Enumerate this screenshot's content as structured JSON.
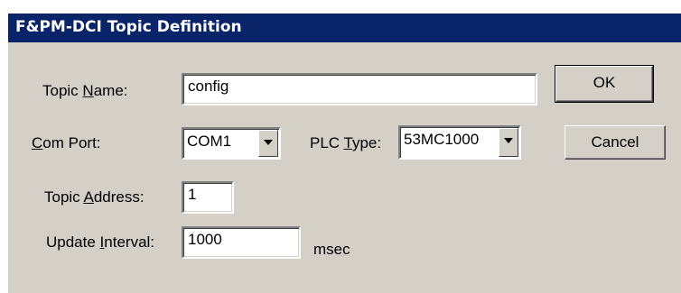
{
  "window": {
    "title": "F&PM-DCI Topic Definition"
  },
  "topic_name": {
    "label_pre": "Topic ",
    "label_accel": "N",
    "label_post": "ame:",
    "value": "config"
  },
  "com_port": {
    "label_pre": "",
    "label_accel": "C",
    "label_post": "om Port:",
    "selected": "COM1"
  },
  "plc_type": {
    "label_pre": "PLC ",
    "label_accel": "T",
    "label_post": "ype:",
    "selected": "53MC1000"
  },
  "topic_address": {
    "label_pre": "Topic ",
    "label_accel": "A",
    "label_post": "ddress:",
    "value": "1"
  },
  "update_interval": {
    "label_pre": "Update ",
    "label_accel": "I",
    "label_post": "nterval:",
    "value": "1000",
    "unit": "msec"
  },
  "buttons": {
    "ok": "OK",
    "cancel": "Cancel"
  },
  "icons": {
    "dropdown": "chevron-down-icon"
  },
  "colors": {
    "titlebar": "#0a246a",
    "face": "#d4d0c8"
  }
}
